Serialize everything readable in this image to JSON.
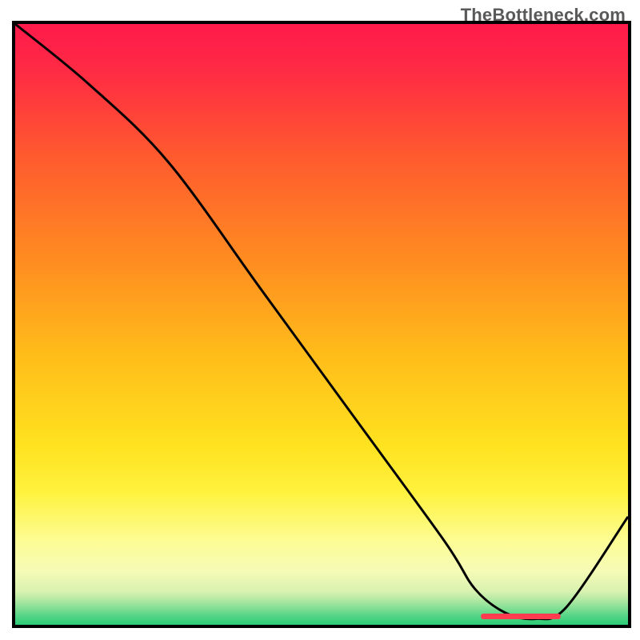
{
  "watermark": "TheBottleneck.com",
  "chart_data": {
    "type": "line",
    "title": "",
    "xlabel": "",
    "ylabel": "",
    "xlim": [
      0,
      100
    ],
    "ylim": [
      0,
      100
    ],
    "background_gradient": {
      "stops": [
        {
          "offset": 0.0,
          "color": "#ff1a4b"
        },
        {
          "offset": 0.08,
          "color": "#ff2b44"
        },
        {
          "offset": 0.22,
          "color": "#ff5a2e"
        },
        {
          "offset": 0.4,
          "color": "#ff8e20"
        },
        {
          "offset": 0.55,
          "color": "#ffbc1a"
        },
        {
          "offset": 0.7,
          "color": "#ffe21f"
        },
        {
          "offset": 0.78,
          "color": "#fff23e"
        },
        {
          "offset": 0.86,
          "color": "#fdfd94"
        },
        {
          "offset": 0.91,
          "color": "#f6fbb6"
        },
        {
          "offset": 0.945,
          "color": "#d8f2b0"
        },
        {
          "offset": 0.965,
          "color": "#9ee49d"
        },
        {
          "offset": 0.985,
          "color": "#55d586"
        },
        {
          "offset": 1.0,
          "color": "#2bcd77"
        }
      ]
    },
    "series": [
      {
        "name": "bottleneck-curve",
        "color": "#000000",
        "x": [
          0,
          12,
          25,
          40,
          55,
          70,
          75,
          80,
          85,
          90,
          100
        ],
        "values": [
          100,
          90,
          77,
          56,
          35,
          14,
          6,
          2,
          1,
          3,
          18
        ]
      }
    ],
    "marker": {
      "name": "optimal-range",
      "x_range": [
        76,
        89
      ],
      "y": 1.4,
      "color": "#ff3b4f"
    }
  }
}
